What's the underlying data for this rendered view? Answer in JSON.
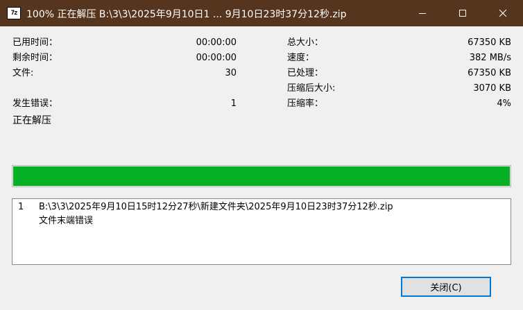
{
  "window": {
    "icon_text": "7z",
    "title": "100% 正在解压 B:\\3\\3\\2025年9月10日1 ... 9月10日23时37分12秒.zip",
    "controls": [
      "minimize-icon",
      "maximize-icon",
      "close-icon"
    ]
  },
  "stats_left": {
    "elapsed_label": "已用时间：",
    "elapsed_value": "00:00:00",
    "remaining_label": "剩余时间：",
    "remaining_value": "00:00:00",
    "files_label": "文件:",
    "files_value": "30",
    "errors_label": "发生错误：",
    "errors_value": "1"
  },
  "stats_right": {
    "total_size_label": "总大小：",
    "total_size_value": "67350 KB",
    "speed_label": "速度：",
    "speed_value": "382 MB/s",
    "processed_label": "已处理：",
    "processed_value": "67350 KB",
    "compressed_size_label": "压缩后大小:",
    "compressed_size_value": "3070 KB",
    "ratio_label": "压缩率：",
    "ratio_value": "4%"
  },
  "status_text": "正在解压",
  "progress": {
    "percent": 100,
    "color": "#06b025"
  },
  "messages": [
    {
      "index": "1",
      "path": "B:\\3\\3\\2025年9月10日15时12分27秒\\新建文件夹\\2025年9月10日23时37分12秒.zip",
      "error": "文件末端错误"
    }
  ],
  "buttons": {
    "close_label": "关闭(C)"
  },
  "colors": {
    "titlebar": "#56351f",
    "accent": "#0078d7"
  }
}
